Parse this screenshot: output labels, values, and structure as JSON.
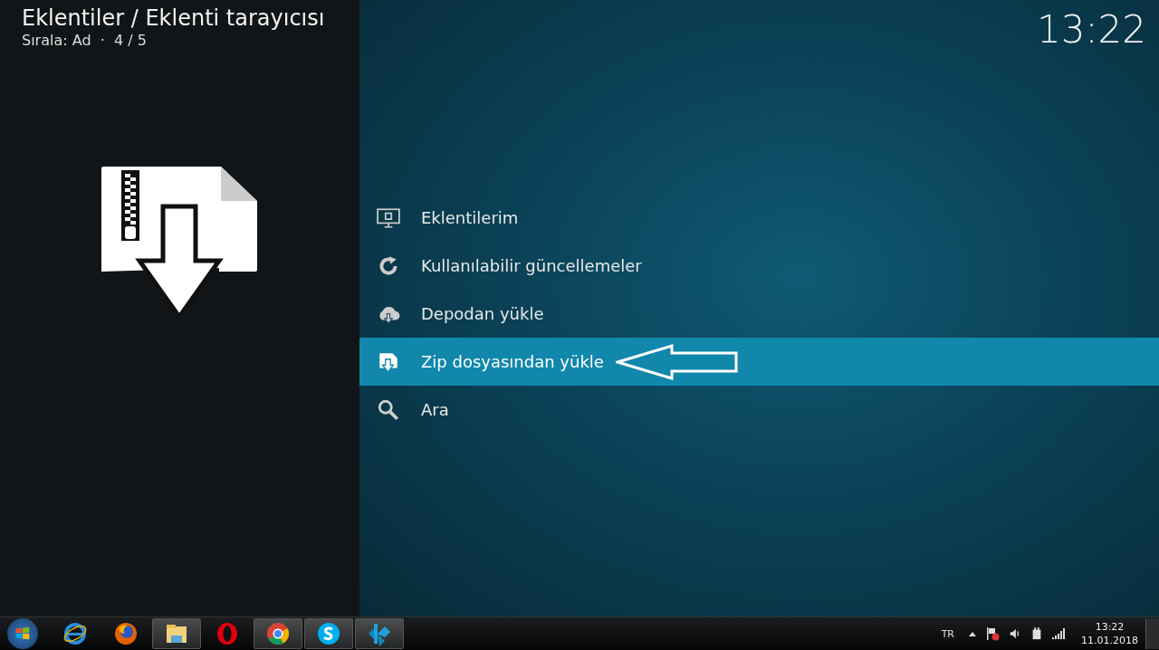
{
  "header": {
    "title": "Eklentiler / Eklenti tarayıcısı",
    "subtitle": "Sırala: Ad  ·  4 / 5",
    "clock": "13:22"
  },
  "menu": [
    {
      "label": "Eklentilerim",
      "selected": false
    },
    {
      "label": "Kullanılabilir güncellemeler",
      "selected": false
    },
    {
      "label": "Depodan yükle",
      "selected": false
    },
    {
      "label": "Zip dosyasından yükle",
      "selected": true
    },
    {
      "label": "Ara",
      "selected": false
    }
  ],
  "taskbar": {
    "apps": [
      {
        "running": false
      },
      {
        "running": false
      },
      {
        "running": true
      },
      {
        "running": false
      },
      {
        "running": true
      },
      {
        "running": true
      },
      {
        "running": true
      }
    ],
    "language": "TR",
    "time": "13:22",
    "date": "11.01.2018"
  }
}
